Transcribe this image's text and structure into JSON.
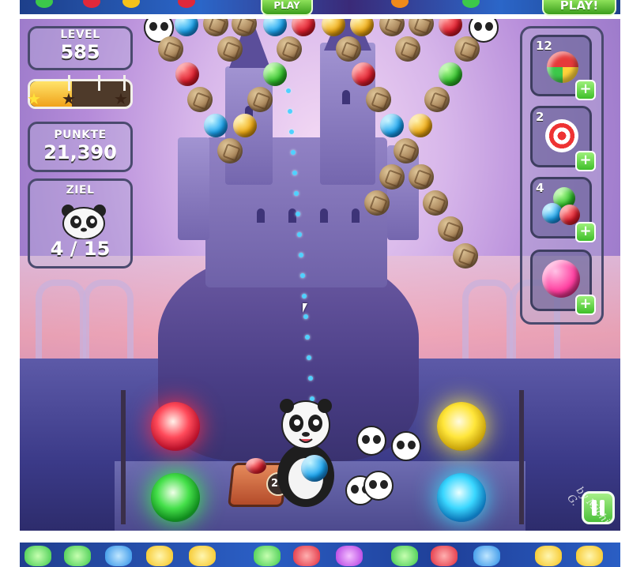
{
  "top_ad": {
    "play_small_label": "PLAY",
    "play_big_label": "PLAY!"
  },
  "hud": {
    "level_label": "LEVEL",
    "level_value": "585",
    "score_label": "PUNKTE",
    "score_value": "21,390",
    "goal_label": "ZIEL",
    "goal_value": "4 / 15",
    "star_progress": 0.42
  },
  "boosters": [
    {
      "count": "12",
      "icon": "striped-ball-icon"
    },
    {
      "count": "2",
      "icon": "target-dart-icon"
    },
    {
      "count": "4",
      "icon": "multicolor-bubbles-icon"
    },
    {
      "count": "",
      "icon": "pink-bomb-bubble-icon"
    }
  ],
  "shooter": {
    "bubbles_left": "23",
    "current_bubble": "blue",
    "next_bubble": "red"
  },
  "watermark": "by Michi G.",
  "colors": {
    "panel_border": "#4a4a6e",
    "accent_green": "#3fbf2a",
    "bubble_red": "#e01c2c",
    "bubble_green": "#2fbf2a",
    "bubble_blue": "#1aa4f0",
    "bubble_gold": "#f0aa12"
  }
}
